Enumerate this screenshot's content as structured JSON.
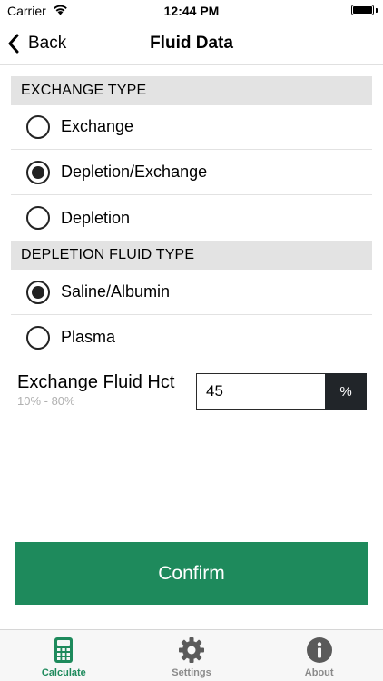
{
  "status_bar": {
    "carrier": "Carrier",
    "time": "12:44 PM"
  },
  "nav": {
    "back_label": "Back",
    "title": "Fluid Data"
  },
  "exchange_type": {
    "header": "EXCHANGE TYPE",
    "options": [
      {
        "label": "Exchange",
        "selected": false
      },
      {
        "label": "Depletion/Exchange",
        "selected": true
      },
      {
        "label": "Depletion",
        "selected": false
      }
    ]
  },
  "depletion_fluid_type": {
    "header": "DEPLETION FLUID TYPE",
    "options": [
      {
        "label": "Saline/Albumin",
        "selected": true
      },
      {
        "label": "Plasma",
        "selected": false
      }
    ]
  },
  "hct": {
    "label": "Exchange Fluid Hct",
    "range": "10% - 80%",
    "value": "45",
    "unit": "%"
  },
  "confirm_label": "Confirm",
  "tabs": [
    {
      "label": "Calculate",
      "icon": "calculator-icon",
      "active": true
    },
    {
      "label": "Settings",
      "icon": "gear-icon",
      "active": false
    },
    {
      "label": "About",
      "icon": "info-icon",
      "active": false
    }
  ],
  "colors": {
    "accent": "#1e8a5c",
    "unit_bg": "#212529",
    "section_bg": "#e3e3e3"
  }
}
